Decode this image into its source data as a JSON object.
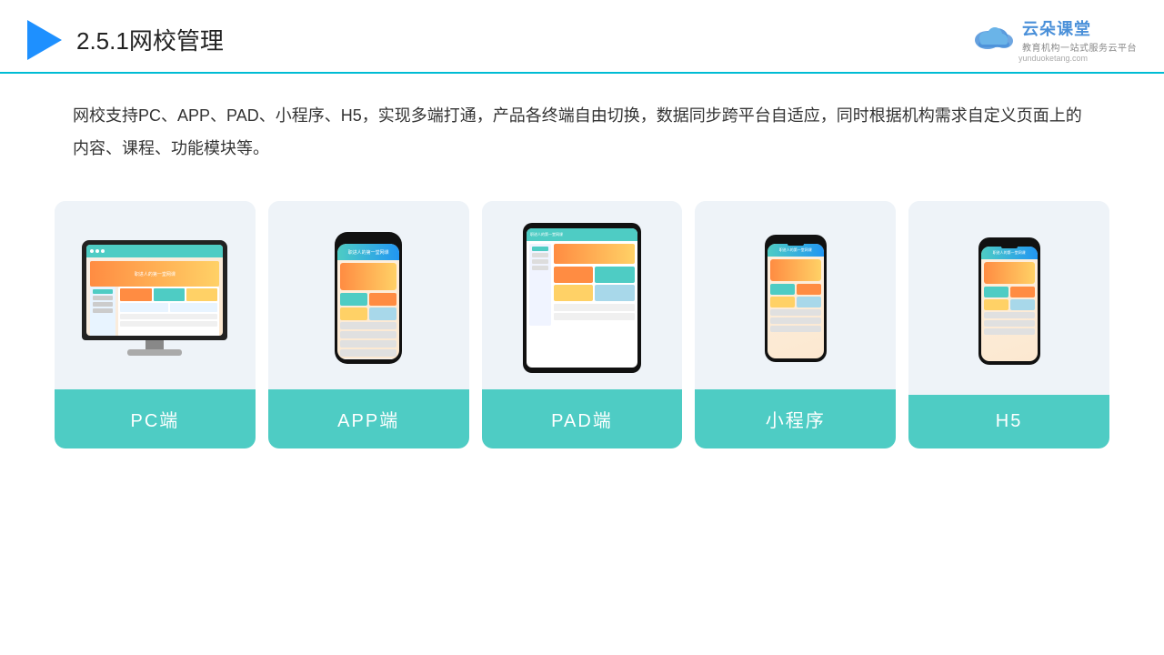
{
  "header": {
    "title_prefix": "2.5.1",
    "title_main": "网校管理"
  },
  "logo": {
    "brand": "云朵课堂",
    "tagline": "教育机构一站式服务云平台",
    "url": "yunduoketang.com"
  },
  "description": "网校支持PC、APP、PAD、小程序、H5，实现多端打通，产品各终端自由切换，数据同步跨平台自适应，同时根据机构需求自定义页面上的内容、课程、功能模块等。",
  "cards": [
    {
      "id": "pc",
      "label": "PC端"
    },
    {
      "id": "app",
      "label": "APP端"
    },
    {
      "id": "pad",
      "label": "PAD端"
    },
    {
      "id": "mini",
      "label": "小程序"
    },
    {
      "id": "h5",
      "label": "H5"
    }
  ],
  "colors": {
    "teal": "#4eccc4",
    "blue": "#1e90ff",
    "accent_orange": "#ff8c42",
    "accent_yellow": "#ffd166"
  }
}
